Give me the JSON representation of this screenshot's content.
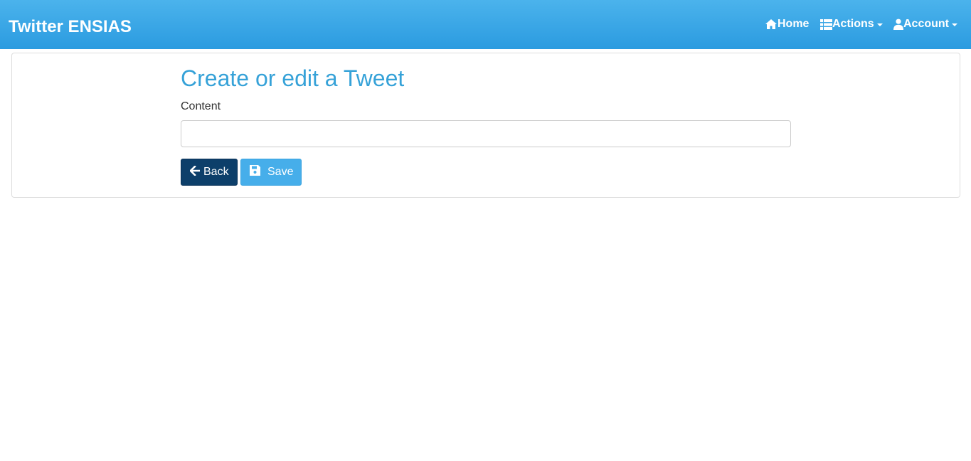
{
  "navbar": {
    "brand": "Twitter ENSIAS",
    "items": [
      {
        "label": "Home",
        "icon": "home-icon"
      },
      {
        "label": "Actions",
        "icon": "th-list-icon",
        "dropdown": true
      },
      {
        "label": "Account",
        "icon": "user-icon",
        "dropdown": true
      }
    ]
  },
  "form": {
    "title": "Create or edit a Tweet",
    "content_label": "Content",
    "content_value": "",
    "back_label": "Back",
    "save_label": "Save"
  },
  "colors": {
    "navbar_top": "#4bb3ec",
    "navbar_bottom": "#2b9be0",
    "title": "#36a2d8",
    "back_button": "#0d3f6a",
    "save_button": "#46aeea"
  }
}
